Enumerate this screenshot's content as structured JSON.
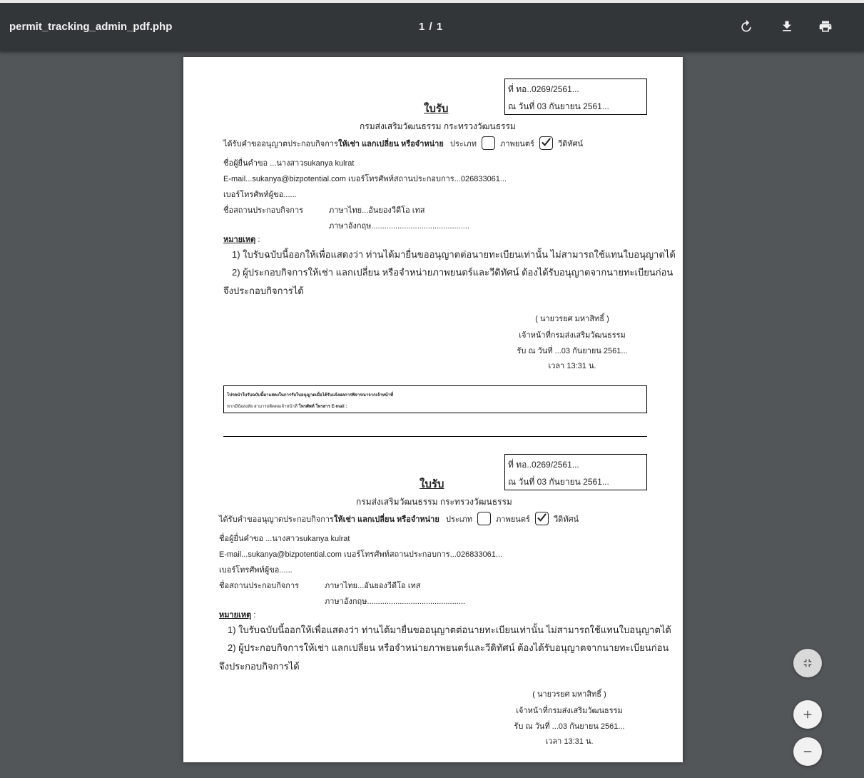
{
  "toolbar": {
    "title": "permit_tracking_admin_pdf.php",
    "page_indicator": "1 / 1",
    "rotate_icon": "rotate-icon",
    "download_icon": "download-icon",
    "print_icon": "print-icon"
  },
  "receipt": {
    "ref_no": "ที่ ทอ..0269/2561...",
    "ref_date": "ณ วันที่ 03 กันยายน 2561...",
    "title": "ใบรับ",
    "department": "กรมส่งเสริมวัฒนธรรม กระทรวงวัฒนธรรม",
    "request_prefix": "ได้รับคำขออนุญาตประกอบกิจการ",
    "request_bold": "ให้เช่า แลกเปลี่ยน หรือจำหน่าย",
    "type_label": "ประเภท",
    "movie_label": "ภาพยนตร์",
    "video_label": "วีดิทัศน์",
    "movie_checked": false,
    "video_checked": true,
    "applicant": "ชื่อผู้ยื่นคำขอ ...นางสาวsukanya  kulrat",
    "contact": "E-mail...sukanya@bizpotential.com เบอร์โทรศัพท์สถานประกอบการ...026833061...",
    "phone": "เบอร์โทรศัพท์ผู้ขอ......",
    "business_label": "ชื่อสถานประกอบกิจการ",
    "business_th": "ภาษาไทย...อันยองวีดีโอ เทส",
    "business_en": "ภาษาอังกฤษ.............................................",
    "note_label": "หมายเหตุ",
    "note_colon": " :",
    "note1": "1) ใบรับฉบับนี้ออกให้เพื่อแสดงว่า ท่านได้มายื่นขออนุญาตต่อนายทะเบียนเท่านั้น ไม่สามารถใช้แทนใบอนุญาตได้",
    "note2": "2) ผู้ประกอบกิจการให้เช่า แลกเปลี่ยน หรือจำหน่ายภาพยนตร์และวีดิทัศน์ ต้องได้รับอนุญาตจากนายทะเบียนก่อน",
    "note3": "จึงประกอบกิจการได้",
    "officer_name": "( นายวรยศ มหาสิทธิ์ )",
    "officer_title": "เจ้าหน้าที่กรมส่งเสริมวัฒนธรรม",
    "received_date": "รับ ณ วันที่ ...03 กันยายน 2561...",
    "received_time": "เวลา 13:31 น.",
    "box_line1": "โปรดนำใบรับฉบับนี้มาแสดงในการรับใบอนุญาตเมื่อได้รับแจ้งผลการพิจารณาจากเจ้าหน้าที่",
    "box_line2_prefix": "หากมีข้อสงสัย สามารถติดต่อเจ้าหน้าที่",
    "box_line2_bold": "โทรศัพท์ โทรสาร E-mail :"
  },
  "controls": {
    "fit_icon": "fit-to-page-icon",
    "zoom_in_icon": "zoom-in-icon",
    "zoom_out_icon": "zoom-out-icon"
  }
}
